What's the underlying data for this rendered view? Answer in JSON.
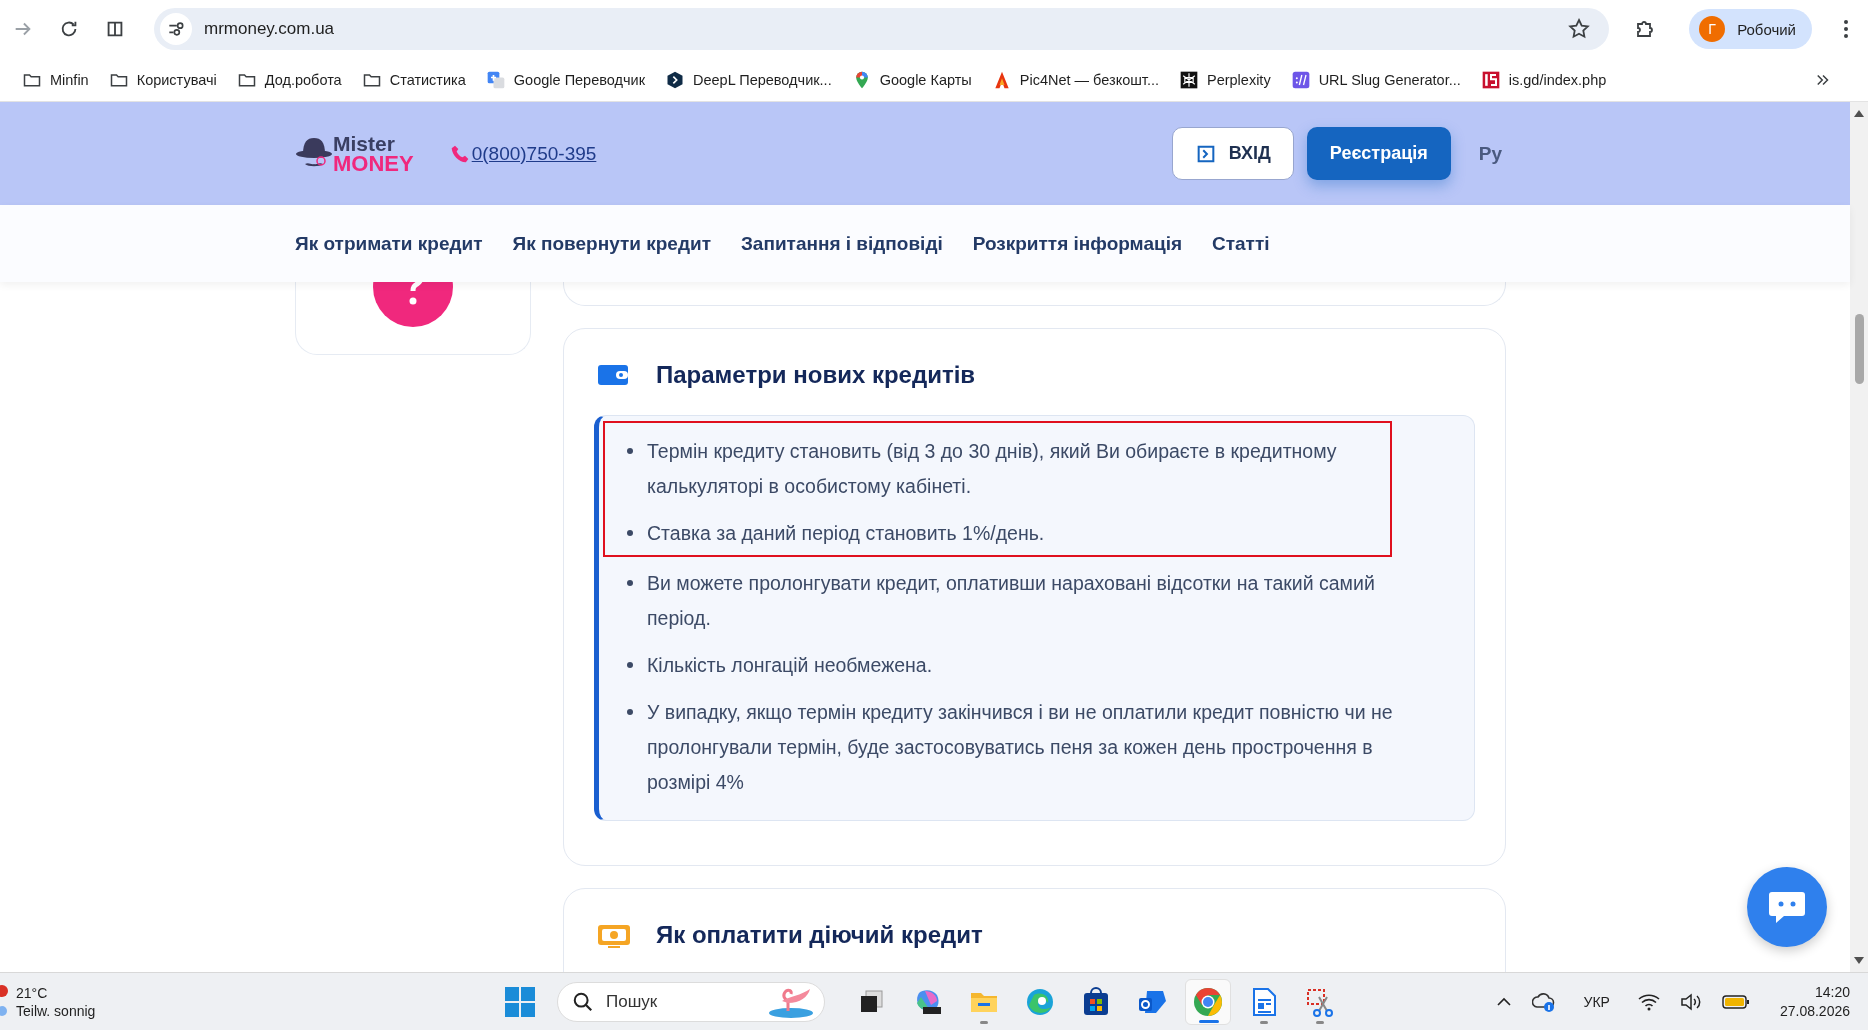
{
  "browser": {
    "url": "mrmoney.com.ua",
    "profile": {
      "initial": "Г",
      "name": "Робочий"
    },
    "bookmarks": [
      {
        "kind": "folder",
        "label": "Minfin"
      },
      {
        "kind": "folder",
        "label": "Користувачі"
      },
      {
        "kind": "folder",
        "label": "Дод.робота"
      },
      {
        "kind": "folder",
        "label": "Статистика"
      },
      {
        "kind": "translate",
        "label": "Google Переводчик"
      },
      {
        "kind": "deepl",
        "label": "DeepL Переводчик..."
      },
      {
        "kind": "maps",
        "label": "Google Карты"
      },
      {
        "kind": "pic4net",
        "label": "Pic4Net — безкошт..."
      },
      {
        "kind": "perplexity",
        "label": "Perplexity"
      },
      {
        "kind": "slug",
        "label": "URL Slug Generator..."
      },
      {
        "kind": "isgd",
        "label": "is.gd/index.php"
      }
    ]
  },
  "site": {
    "logo": {
      "line1": "Mister",
      "line2": "MONEY"
    },
    "phone": "0(800)750-395",
    "login_button": "ВХІД",
    "register_button": "Реєстрація",
    "language": "Ру",
    "nav": [
      "Як отримати кредит",
      "Як повернути кредит",
      "Запитання і відповіді",
      "Розкриття інформація",
      "Статті"
    ]
  },
  "sections": [
    {
      "kind": "wallet",
      "title": "Параметри нових кредитів",
      "items": [
        {
          "text": "Термін кредиту становить (від 3 до 30 днів), який Ви обираєте в кредитному калькуляторі в особистому кабінеті.",
          "highlighted": true
        },
        {
          "text": "Ставка за даний період становить 1%/день.",
          "highlighted": true
        },
        {
          "text": "Ви можете пролонгувати кредит, оплативши нараховані відсотки на такий самий період.",
          "highlighted": false
        },
        {
          "text": "Кількість лонгацій необмежена.",
          "highlighted": false
        },
        {
          "text": "У випадку, якщо термін кредиту закінчився і ви не оплатили кредит повністю чи не пролонгували термін, буде застосовуватись пеня за кожен день прострочення в розмірі 4%",
          "highlighted": false
        }
      ]
    },
    {
      "kind": "payment",
      "title": "Як оплатити діючий кредит"
    }
  ],
  "taskbar": {
    "weather": {
      "temperature": "21°C",
      "condition": "Teilw. sonnig"
    },
    "search": {
      "placeholder": "Пошук"
    },
    "apps": [
      {
        "kind": "taskview",
        "running": false,
        "selected": false
      },
      {
        "kind": "m365",
        "running": false,
        "selected": false
      },
      {
        "kind": "explorer",
        "running": true,
        "selected": false
      },
      {
        "kind": "edge",
        "running": false,
        "selected": false
      },
      {
        "kind": "store",
        "running": false,
        "selected": false
      },
      {
        "kind": "outlook",
        "running": false,
        "selected": false
      },
      {
        "kind": "chrome",
        "running": true,
        "selected": true
      },
      {
        "kind": "writer",
        "running": true,
        "selected": false
      },
      {
        "kind": "snip",
        "running": true,
        "selected": false
      }
    ],
    "language": "УКР",
    "time": "14:20",
    "date": "27.08.2026"
  }
}
